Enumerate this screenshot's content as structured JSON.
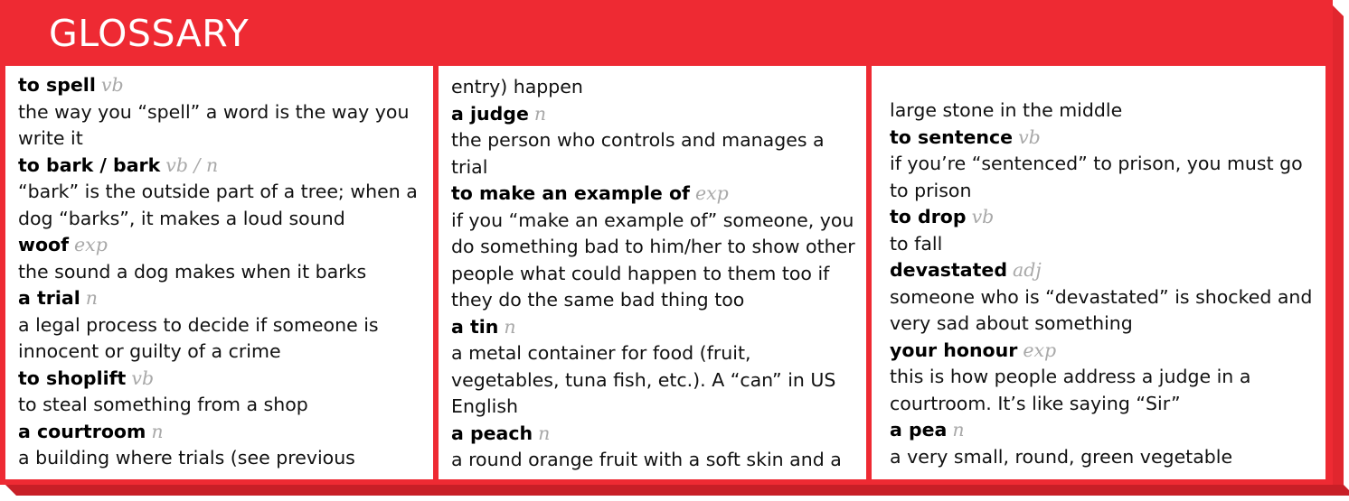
{
  "title": "GLOSSARY",
  "columns": [
    {
      "lead": "",
      "entries": [
        {
          "term": "to spell",
          "pos": "vb",
          "definition": "the way you “spell” a word is the way you write it"
        },
        {
          "term": "to bark / bark",
          "pos": "vb / n",
          "definition": "“bark” is the outside part of a tree; when a dog “barks”, it makes a loud sound"
        },
        {
          "term": "woof",
          "pos": "exp",
          "definition": "the sound a dog makes when it barks"
        },
        {
          "term": "a trial",
          "pos": "n",
          "definition": "a legal process to decide if someone is innocent or guilty of a crime"
        },
        {
          "term": "to shoplift",
          "pos": "vb",
          "definition": "to steal something from a shop"
        },
        {
          "term": "a courtroom",
          "pos": "n",
          "definition": "a building where trials (see previous"
        }
      ]
    },
    {
      "lead": "entry) happen",
      "entries": [
        {
          "term": "a judge",
          "pos": "n",
          "definition": "the person who controls and manages a trial"
        },
        {
          "term": "to make an example of",
          "pos": "exp",
          "definition": "if you “make an example of” someone, you do something bad to him/her to show other people what could happen to them too if they do the same bad thing too"
        },
        {
          "term": "a tin",
          "pos": "n",
          "definition": "a metal container for food (fruit, vegetables, tuna fish, etc.). A “can” in US English"
        },
        {
          "term": "a peach",
          "pos": "n",
          "definition": "a round orange fruit with a soft skin and a"
        }
      ]
    },
    {
      "lead": "large stone in the middle",
      "entries": [
        {
          "term": "to sentence",
          "pos": "vb",
          "definition": "if you’re “sentenced” to prison, you must go to prison"
        },
        {
          "term": "to drop",
          "pos": "vb",
          "definition": "to fall"
        },
        {
          "term": "devastated",
          "pos": "adj",
          "definition": "someone who is “devastated” is shocked and very sad about something"
        },
        {
          "term": "your honour",
          "pos": "exp",
          "definition": "this is how people address a judge in a courtroom. It’s like saying “Sir”"
        },
        {
          "term": "a pea",
          "pos": "n",
          "definition": "a very small, round, green vegetable"
        }
      ]
    }
  ],
  "colors": {
    "frame": "#ee2a33",
    "title_text": "#ffffff",
    "pos_text": "#a9a9a9"
  }
}
